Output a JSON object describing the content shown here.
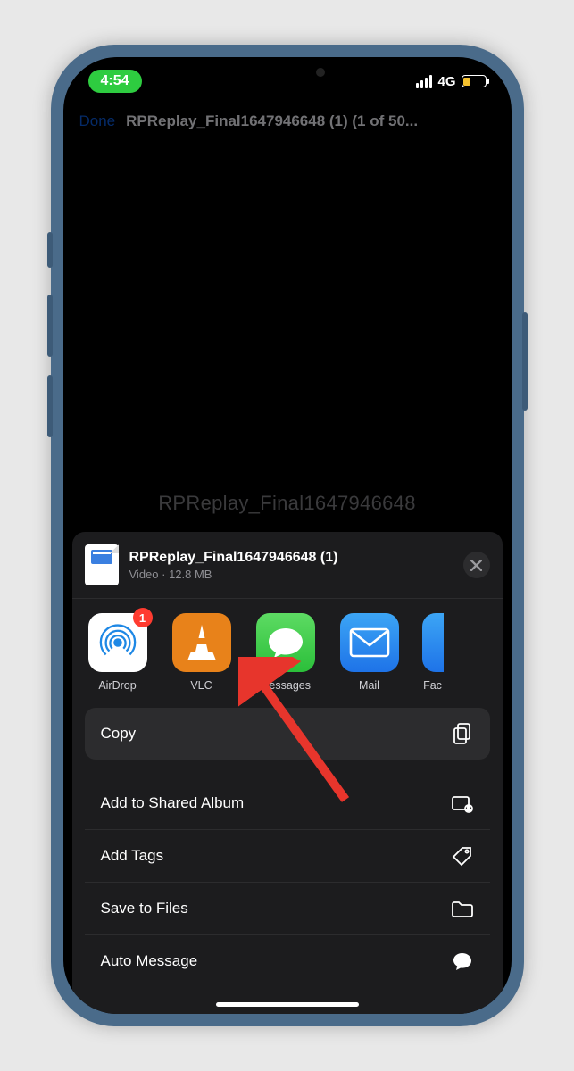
{
  "status": {
    "time": "4:54",
    "network": "4G"
  },
  "nav": {
    "done": "Done",
    "title": "RPReplay_Final1647946648 (1) (1 of 50..."
  },
  "background_title": "RPReplay_Final1647946648",
  "share": {
    "file_name": "RPReplay_Final1647946648 (1)",
    "file_meta": "Video · 12.8 MB",
    "apps": [
      {
        "label": "AirDrop",
        "badge": "1"
      },
      {
        "label": "VLC"
      },
      {
        "label": "Messages"
      },
      {
        "label": "Mail"
      },
      {
        "label": "Fac"
      }
    ],
    "copy": "Copy",
    "actions": [
      "Add to Shared Album",
      "Add Tags",
      "Save to Files",
      "Auto Message"
    ]
  }
}
